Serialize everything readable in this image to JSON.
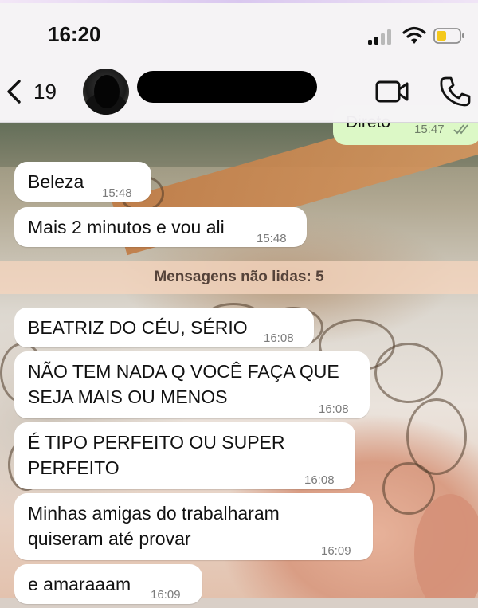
{
  "status_bar": {
    "time": "16:20"
  },
  "header": {
    "back_count": "19"
  },
  "unread_banner": "Mensagens não lidas: 5",
  "messages": [
    {
      "text": "Direto",
      "time": "15:47",
      "outgoing": true
    },
    {
      "text": "Beleza",
      "time": "15:48"
    },
    {
      "text": "Mais 2 minutos e vou ali",
      "time": "15:48"
    },
    {
      "text": "BEATRIZ DO CÉU, SÉRIO",
      "time": "16:08"
    },
    {
      "line1": "NÃO TEM NADA Q VOCÊ FAÇA QUE",
      "line2": "SEJA MAIS OU MENOS",
      "time": "16:08"
    },
    {
      "line1": "É TIPO PERFEITO OU SUPER",
      "line2": "PERFEITO",
      "time": "16:08"
    },
    {
      "line1": "Minhas amigas do trabalharam",
      "line2": "quiseram até provar",
      "time": "16:09"
    },
    {
      "text": "e amaraaam",
      "time": "16:09"
    }
  ],
  "colors": {
    "outgoing_bubble": "#dcf8c6",
    "incoming_bubble": "#ffffff",
    "battery_level": "#f4c81b",
    "unread_banner": "#f5d5be"
  },
  "icons": {
    "back": "chevron-left-icon",
    "video": "video-camera-icon",
    "call": "phone-icon"
  }
}
